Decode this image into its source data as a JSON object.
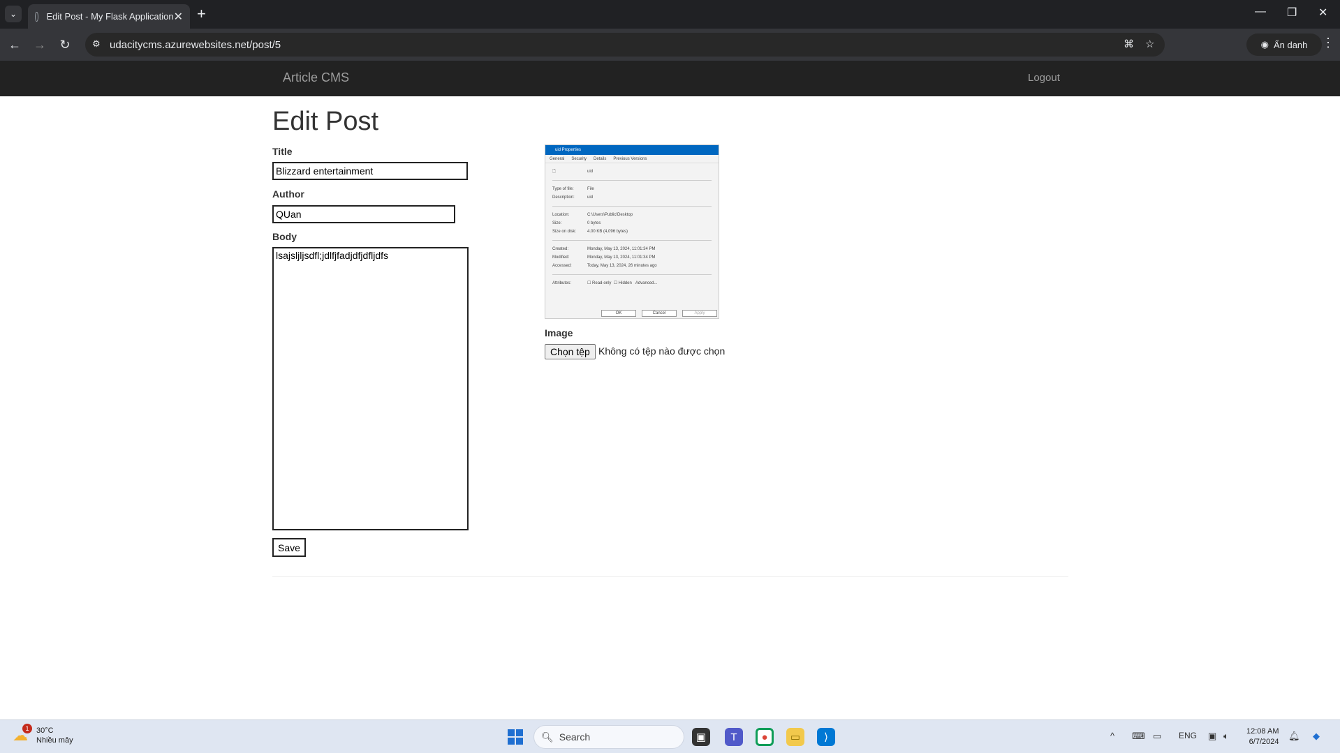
{
  "browser": {
    "tab_title": "Edit Post - My Flask Application",
    "url": "udacitycms.azurewebsites.net/post/5",
    "profile_label": "Ẩn danh"
  },
  "navbar": {
    "brand": "Article CMS",
    "logout": "Logout"
  },
  "form": {
    "heading": "Edit Post",
    "title_label": "Title",
    "title_value": "Blizzard entertainment",
    "author_label": "Author",
    "author_value": "QUan",
    "body_label": "Body",
    "body_value": "lsajsljljsdfl;jdlfjfadjdfjdfljdfs",
    "save_label": "Save",
    "image_label": "Image",
    "file_button": "Chọn tệp",
    "file_status": "Không có tệp nào được chọn"
  },
  "thumbnail": {
    "title": "uid Properties",
    "tabs": [
      "General",
      "Security",
      "Details",
      "Previous Versions"
    ],
    "file_name": "uid",
    "rows1": [
      {
        "k": "Type of file:",
        "v": "File"
      },
      {
        "k": "Description:",
        "v": "uid"
      }
    ],
    "rows2": [
      {
        "k": "Location:",
        "v": "C:\\Users\\Public\\Desktop"
      },
      {
        "k": "Size:",
        "v": "0 bytes"
      },
      {
        "k": "Size on disk:",
        "v": "4.00 KB (4,096 bytes)"
      }
    ],
    "rows3": [
      {
        "k": "Created:",
        "v": "Monday, May 13, 2024, 11:01:34 PM"
      },
      {
        "k": "Modified:",
        "v": "Monday, May 13, 2024, 11:01:34 PM"
      },
      {
        "k": "Accessed:",
        "v": "Today, May 13, 2024, 26 minutes ago"
      }
    ],
    "attributes": "Attributes:",
    "read_only": "Read-only",
    "hidden": "Hidden",
    "advanced": "Advanced...",
    "ok": "OK",
    "cancel": "Cancel",
    "apply": "Apply"
  },
  "taskbar": {
    "temp": "30°C",
    "weather_desc": "Nhiều mây",
    "weather_badge": "1",
    "search_placeholder": "Search",
    "lang": "ENG",
    "time": "12:08 AM",
    "date": "6/7/2024"
  },
  "colors": {
    "navbar_bg": "#222222",
    "chrome_bg": "#202124",
    "taskbar_bg": "#dfe6f2"
  }
}
